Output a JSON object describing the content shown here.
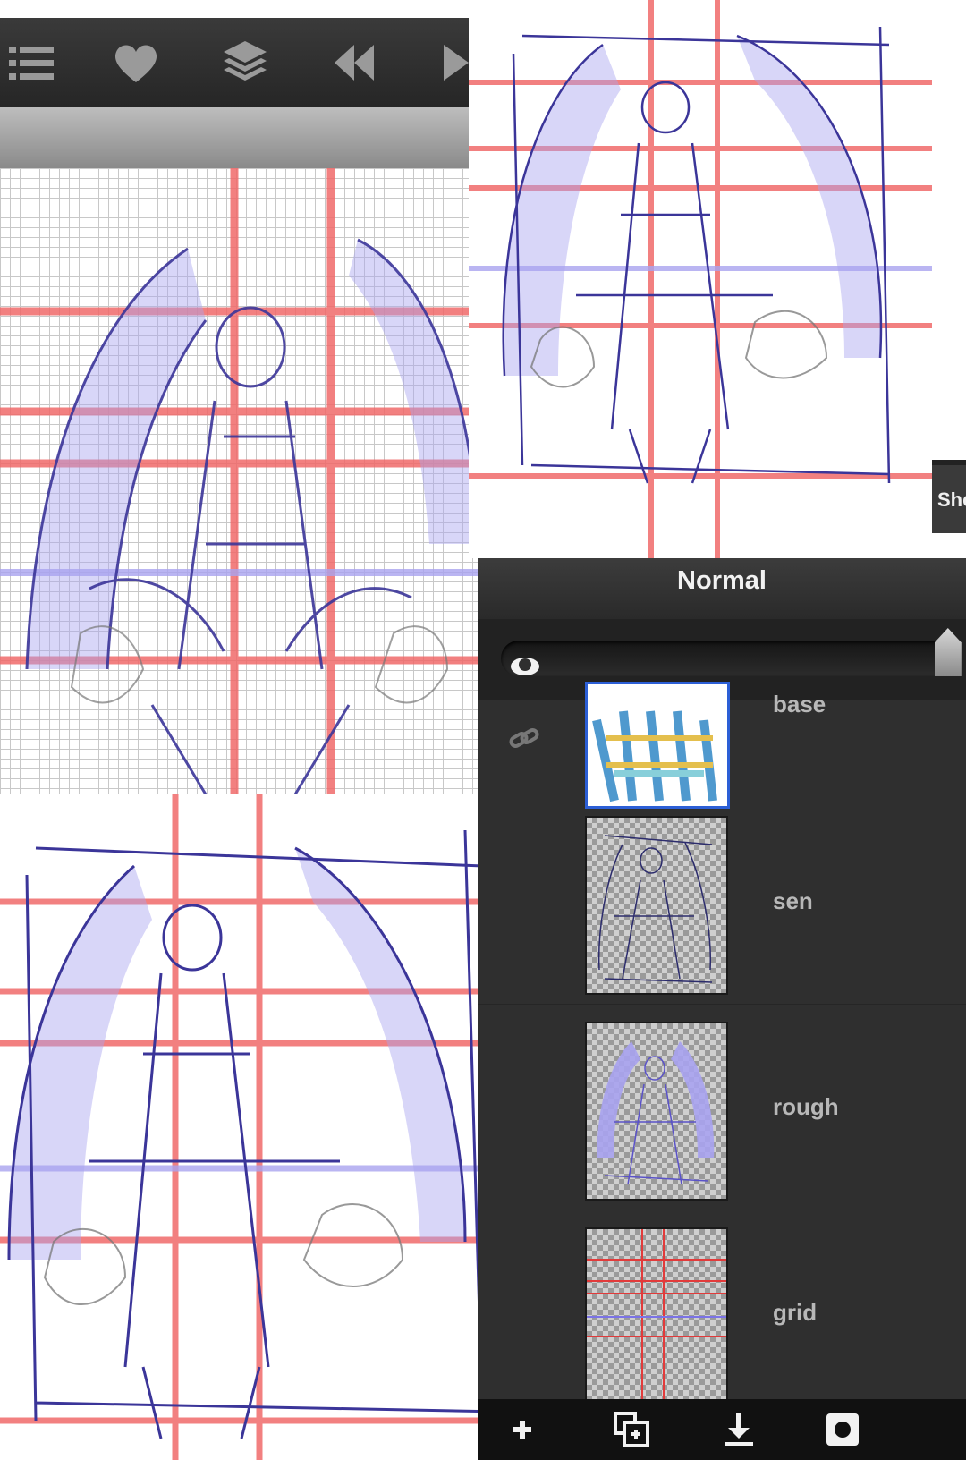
{
  "toolbar": {
    "icons": [
      "menu-icon",
      "heart-icon",
      "layers-icon",
      "rewind-icon",
      "play-icon"
    ]
  },
  "side_tab": {
    "label": "She"
  },
  "layers_panel": {
    "blend_mode": "Normal",
    "opacity_slider": {
      "value_fraction": 0.98
    },
    "layers": [
      {
        "name": "base",
        "selected": true,
        "thumb": "color-art"
      },
      {
        "name": "sen",
        "selected": false,
        "thumb": "lineart"
      },
      {
        "name": "rough",
        "selected": false,
        "thumb": "rough-sketch"
      },
      {
        "name": "grid",
        "selected": false,
        "thumb": "grid-lines"
      }
    ],
    "bottom_toolbar": [
      "add-layer-icon",
      "duplicate-layer-icon",
      "download-icon",
      "mask-icon"
    ]
  },
  "colors": {
    "guide_red": "#f06a6a",
    "guide_purple": "#a9a3f0",
    "sketch_ink": "#3b3599",
    "panel_bg": "#2f2f2f",
    "selection_blue": "#2c5fd6"
  }
}
